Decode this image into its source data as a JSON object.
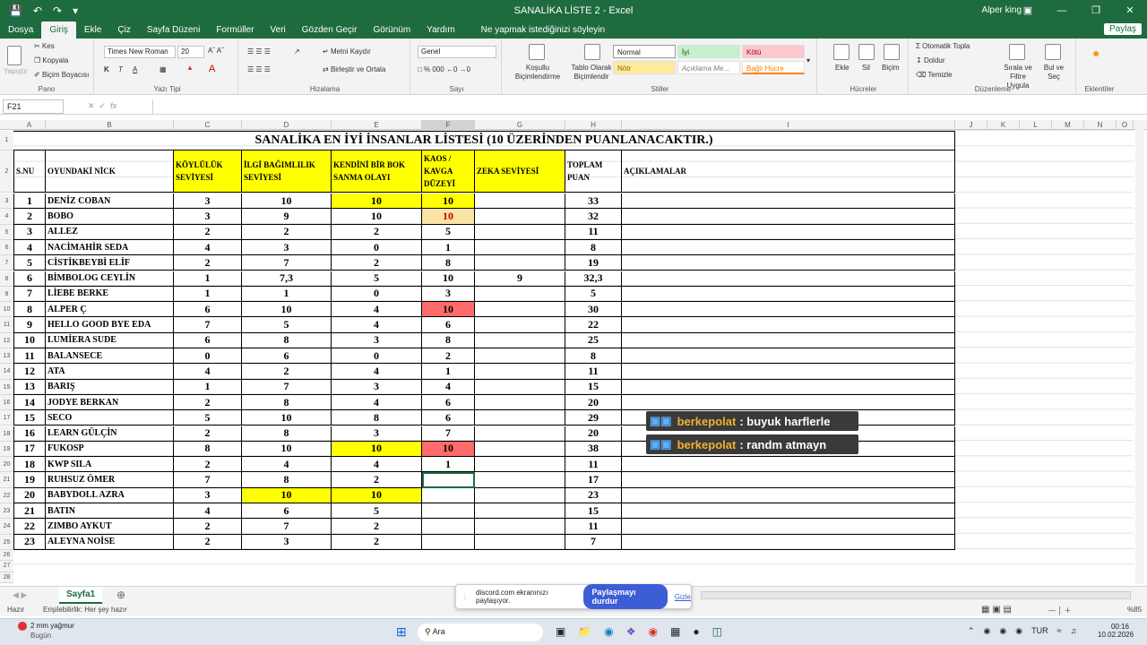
{
  "titlebar": {
    "title": "SANALİKA LİSTE 2  -  Excel",
    "user": "Alper king"
  },
  "tabs": [
    "Dosya",
    "Giriş",
    "Ekle",
    "Çiz",
    "Sayfa Düzeni",
    "Formüller",
    "Veri",
    "Gözden Geçir",
    "Görünüm",
    "Yardım"
  ],
  "tab_search": "Ne yapmak istediğinizi söyleyin",
  "share_label": "Paylaş",
  "ribbon": {
    "clipboard": {
      "paste": "Yapıştır",
      "cut": "Kes",
      "copy": "Kopyala",
      "painter": "Biçim Boyacısı",
      "label": "Pano"
    },
    "font": {
      "name": "Times New Roman",
      "size": "20",
      "label": "Yazı Tipi"
    },
    "alignment": {
      "wrap": "Metni Kaydır",
      "merge": "Birleştir ve Ortala",
      "label": "Hizalama"
    },
    "number": {
      "format": "Genel",
      "label": "Sayı"
    },
    "styles": {
      "cond": "Koşullu Biçimlendirme",
      "table": "Tablo Olarak Biçimlendir",
      "normal": "Normal",
      "good": "İyi",
      "bad": "Kötü",
      "neutral": "Nötr",
      "explanatory": "Açıklama Me...",
      "linked": "Bağlı Hücre",
      "label": "Stiller"
    },
    "cells": {
      "insert": "Ekle",
      "delete": "Sil",
      "format": "Biçim",
      "label": "Hücreler"
    },
    "editing": {
      "autosum": "Otomatik Topla",
      "fill": "Doldur",
      "clear": "Temizle",
      "sort": "Sırala ve Filtre Uygula",
      "find": "Bul ve Seç",
      "label": "Düzenleme"
    },
    "addins": {
      "label": "Eklentiler"
    }
  },
  "namebox": "F21",
  "columns": [
    "A",
    "B",
    "C",
    "D",
    "E",
    "F",
    "G",
    "H",
    "I",
    "J",
    "K",
    "L",
    "M",
    "N",
    "O"
  ],
  "sheet": {
    "title": "SANALİKA EN İYİ İNSANLAR LİSTESİ  (10 ÜZERİNDEN PUANLANACAKTIR.)",
    "headers": [
      "S.NU",
      "OYUNDAKİ NİCK",
      "KÖYLÜLÜK SEVİYESİ",
      "İLGİ BAĞIMLILIK SEVİYESİ",
      "KENDİNİ BİR BOK SANMA OLAYI",
      "KAOS / KAVGA DÜZEYİ",
      "ZEKA SEVİYESİ",
      "TOPLAM PUAN",
      "AÇIKLAMALAR"
    ],
    "rows": [
      [
        "1",
        "DENİZ COBAN",
        "3",
        "10",
        "10",
        "10",
        "",
        "33"
      ],
      [
        "2",
        "BOBO",
        "3",
        "9",
        "10",
        "10",
        "",
        "32"
      ],
      [
        "3",
        "ALLEZ",
        "2",
        "2",
        "2",
        "5",
        "",
        "11"
      ],
      [
        "4",
        "NACİMAHİR SEDA",
        "4",
        "3",
        "0",
        "1",
        "",
        "8"
      ],
      [
        "5",
        "CİSTİKBEYBİ ELİF",
        "2",
        "7",
        "2",
        "8",
        "",
        "19"
      ],
      [
        "6",
        "BİMBOLOG CEYLİN",
        "1",
        "7,3",
        "5",
        "10",
        "9",
        "32,3"
      ],
      [
        "7",
        "LİEBE BERKE",
        "1",
        "1",
        "0",
        "3",
        "",
        "5"
      ],
      [
        "8",
        "ALPER Ç",
        "6",
        "10",
        "4",
        "10",
        "",
        "30"
      ],
      [
        "9",
        "HELLO GOOD BYE EDA",
        "7",
        "5",
        "4",
        "6",
        "",
        "22"
      ],
      [
        "10",
        "LUMİERA SUDE",
        "6",
        "8",
        "3",
        "8",
        "",
        "25"
      ],
      [
        "11",
        "BALANSECE",
        "0",
        "6",
        "0",
        "2",
        "",
        "8"
      ],
      [
        "12",
        "ATA",
        "4",
        "2",
        "4",
        "1",
        "",
        "11"
      ],
      [
        "13",
        "BARIŞ",
        "1",
        "7",
        "3",
        "4",
        "",
        "15"
      ],
      [
        "14",
        "JODYE BERKAN",
        "2",
        "8",
        "4",
        "6",
        "",
        "20"
      ],
      [
        "15",
        "SECO",
        "5",
        "10",
        "8",
        "6",
        "",
        "29"
      ],
      [
        "16",
        "LEARN GÜLÇİN",
        "2",
        "8",
        "3",
        "7",
        "",
        "20"
      ],
      [
        "17",
        "FUKOSP",
        "8",
        "10",
        "10",
        "10",
        "",
        "38"
      ],
      [
        "18",
        "KWP SILA",
        "2",
        "4",
        "4",
        "1",
        "",
        "11"
      ],
      [
        "19",
        "RUHSUZ ÖMER",
        "7",
        "8",
        "2",
        "",
        "",
        "17"
      ],
      [
        "20",
        "BABYDOLL AZRA",
        "3",
        "10",
        "10",
        "",
        "",
        "23"
      ],
      [
        "21",
        "BATIN",
        "4",
        "6",
        "5",
        "",
        "",
        "15"
      ],
      [
        "22",
        "ZIMBO AYKUT",
        "2",
        "7",
        "2",
        "",
        "",
        "11"
      ],
      [
        "23",
        "ALEYNA NOİSE",
        "2",
        "3",
        "2",
        "",
        "",
        "7"
      ]
    ],
    "fills": {
      "yellow": "#ffff00",
      "red": "#ff6b6b",
      "orange": "#fbe3a6"
    }
  },
  "overlay": [
    {
      "user": "berkepolat",
      "text": ": buyuk harflerle"
    },
    {
      "user": "berkepolat",
      "text": ": randm atmayn"
    }
  ],
  "sheet_tab": "Sayfa1",
  "status": {
    "ready": "Hazır",
    "access": "Erişilebilirlik: Her şey hazır",
    "zoom": "%85"
  },
  "discord": {
    "msg": "discord.com ekranınızı paylaşıyor.",
    "stop": "Paylaşmayı durdur",
    "hide": "Gizle"
  },
  "taskbar": {
    "weather": "2 mm yağmur",
    "weather_sub": "Bugün",
    "search": "Ara",
    "lang": "TUR",
    "time": "00:16",
    "date": "10.02.2026"
  }
}
